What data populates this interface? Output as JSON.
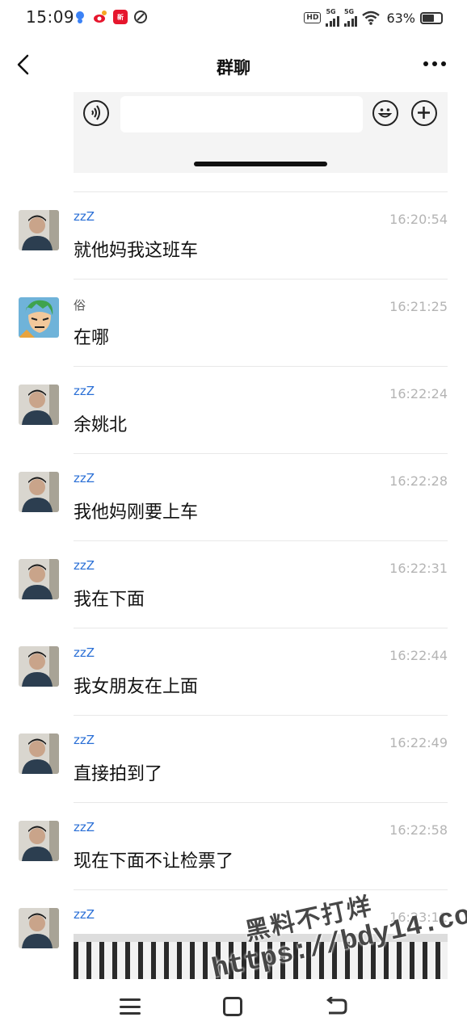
{
  "status_bar": {
    "time": "15:09",
    "hd": "HD",
    "net1": "5G",
    "net2": "5G",
    "battery": "63%"
  },
  "header": {
    "title": "群聊"
  },
  "messages": [
    {
      "sender": "zzZ",
      "time": "16:20:54",
      "text": "就他妈我这班车"
    },
    {
      "sender": "俗",
      "time": "16:21:25",
      "text": "在哪"
    },
    {
      "sender": "zzZ",
      "time": "16:22:24",
      "text": "余姚北"
    },
    {
      "sender": "zzZ",
      "time": "16:22:28",
      "text": "我他妈刚要上车"
    },
    {
      "sender": "zzZ",
      "time": "16:22:31",
      "text": "我在下面"
    },
    {
      "sender": "zzZ",
      "time": "16:22:44",
      "text": "我女朋友在上面"
    },
    {
      "sender": "zzZ",
      "time": "16:22:49",
      "text": "直接拍到了"
    },
    {
      "sender": "zzZ",
      "time": "16:22:58",
      "text": "现在下面不让检票了"
    },
    {
      "sender": "zzZ",
      "time": "16:23:11",
      "text": ""
    }
  ],
  "watermark": {
    "line1": "黑料不打烊",
    "line2": "https://bdy14.co"
  },
  "icons": {
    "back": "chevron-left-icon",
    "more": "more-dots-icon",
    "voice": "voice-icon",
    "emoji": "emoji-icon",
    "plus": "plus-icon",
    "nav_menu": "menu-icon",
    "nav_home": "home-icon",
    "nav_back": "back-icon"
  },
  "colors": {
    "sender_blue": "#2a6fd6",
    "timestamp": "#b4b4b4",
    "divider": "#e8e8e8"
  }
}
